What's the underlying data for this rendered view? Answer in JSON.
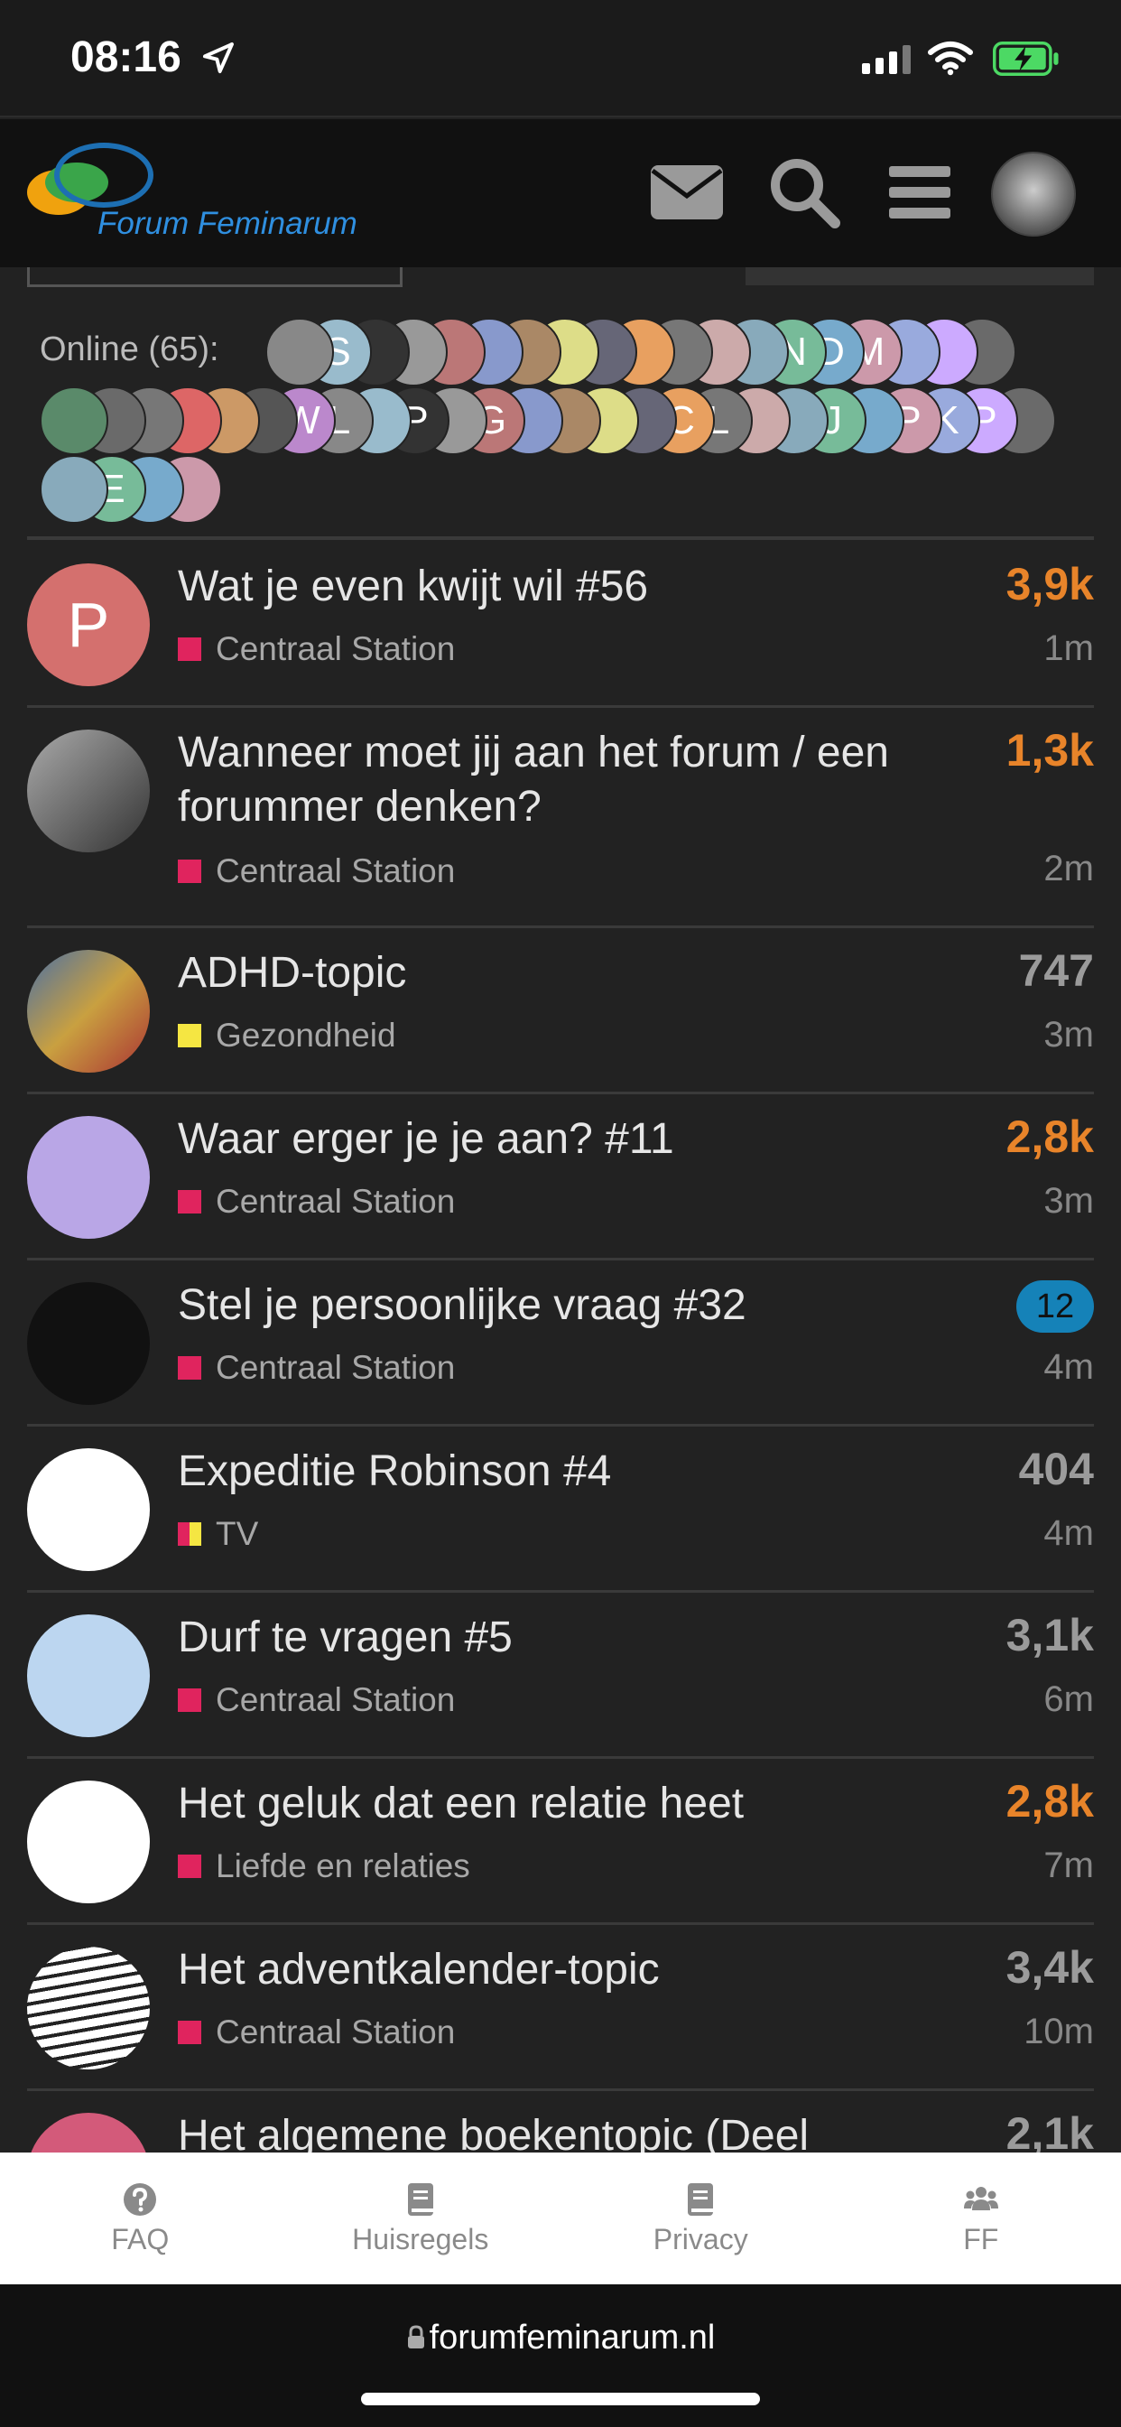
{
  "status_bar": {
    "time": "08:16"
  },
  "header": {
    "logo_text": "Forum Feminarum"
  },
  "online": {
    "label": "Online (65):",
    "rows": [
      [
        "",
        "S",
        "",
        "",
        "",
        "",
        "",
        "",
        "",
        "",
        "",
        "",
        "",
        "N",
        "D",
        "M",
        "",
        "",
        ""
      ],
      [
        "",
        "",
        "",
        "",
        "",
        "",
        "W",
        "L",
        "",
        "P",
        "",
        "G",
        "",
        "",
        "",
        "",
        "C",
        "L",
        "",
        "",
        "J",
        "",
        "P",
        "K",
        "P",
        ""
      ],
      [
        "",
        "E",
        "",
        ""
      ]
    ]
  },
  "topics": [
    {
      "title": "Wat je even kwijt wil #56",
      "category": "Centraal Station",
      "cat_color": "#e0245e",
      "count": "3,9k",
      "count_style": "orange",
      "ago": "1m",
      "avatar_letter": "P"
    },
    {
      "title": "Wanneer moet jij aan het forum / een forummer denken?",
      "category": "Centraal Station",
      "cat_color": "#e0245e",
      "count": "1,3k",
      "count_style": "orange",
      "ago": "2m",
      "avatar_letter": ""
    },
    {
      "title": "ADHD-topic",
      "category": "Gezondheid",
      "cat_color": "#f5e642",
      "count": "747",
      "count_style": "gray",
      "ago": "3m",
      "avatar_letter": ""
    },
    {
      "title": "Waar erger je je aan? #11",
      "category": "Centraal Station",
      "cat_color": "#e0245e",
      "count": "2,8k",
      "count_style": "orange",
      "ago": "3m",
      "avatar_letter": ""
    },
    {
      "title": "Stel je persoonlijke vraag #32",
      "category": "Centraal Station",
      "cat_color": "#e0245e",
      "count": "12",
      "count_style": "badge",
      "ago": "4m",
      "avatar_letter": ""
    },
    {
      "title": "Expeditie Robinson #4",
      "category": "TV",
      "cat_color": "#f5e642",
      "count": "404",
      "count_style": "gray",
      "ago": "4m",
      "avatar_letter": ""
    },
    {
      "title": "Durf te vragen #5",
      "category": "Centraal Station",
      "cat_color": "#e0245e",
      "count": "3,1k",
      "count_style": "gray",
      "ago": "6m",
      "avatar_letter": ""
    },
    {
      "title": "Het geluk dat een relatie heet",
      "category": "Liefde en relaties",
      "cat_color": "#e0245e",
      "count": "2,8k",
      "count_style": "orange",
      "ago": "7m",
      "avatar_letter": ""
    },
    {
      "title": "Het adventkalender-topic",
      "category": "Centraal Station",
      "cat_color": "#e0245e",
      "count": "3,4k",
      "count_style": "gray",
      "ago": "10m",
      "avatar_letter": ""
    },
    {
      "title": "Het algemene boekentopic (Deel",
      "category": "",
      "cat_color": "#e0245e",
      "count": "2,1k",
      "count_style": "gray",
      "ago": "",
      "avatar_letter": ""
    }
  ],
  "footer": {
    "items": [
      {
        "label": "FAQ",
        "icon": "question-circle-icon"
      },
      {
        "label": "Huisregels",
        "icon": "book-icon"
      },
      {
        "label": "Privacy",
        "icon": "book-icon"
      },
      {
        "label": "FF",
        "icon": "users-icon"
      }
    ]
  },
  "browser": {
    "url": "forumfeminarum.nl"
  }
}
